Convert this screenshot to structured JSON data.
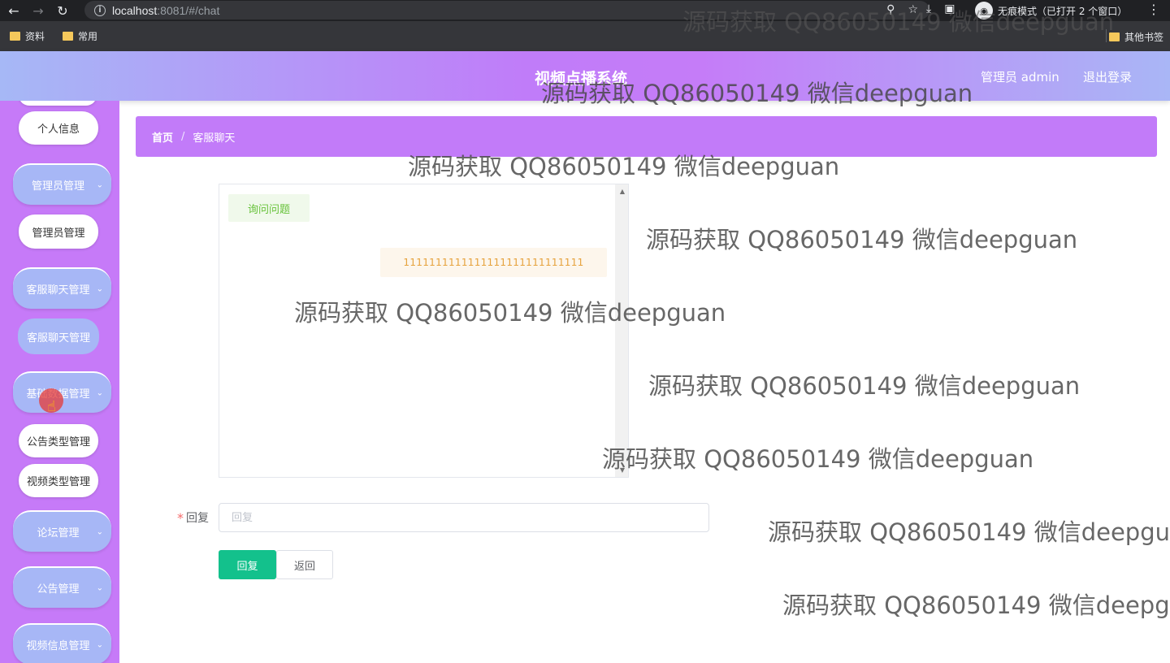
{
  "browser": {
    "url_host": "localhost",
    "url_rest": ":8081/#/chat",
    "incognito_label": "无痕模式（已打开 2 个窗口）",
    "bookmarks": [
      "资料",
      "常用"
    ],
    "other_bookmarks": "其他书签"
  },
  "header": {
    "title": "视频点播系统",
    "admin": "管理员 admin",
    "logout": "退出登录"
  },
  "sidebar": {
    "personal_info": "个人信息",
    "admin_manage_group": "管理员管理",
    "admin_manage": "管理员管理",
    "chat_manage_group": "客服聊天管理",
    "chat_manage": "客服聊天管理",
    "base_data_group": "基础数据管理",
    "notice_type": "公告类型管理",
    "video_type": "视频类型管理",
    "forum_group": "论坛管理",
    "notice_group": "公告管理",
    "video_info_group": "视频信息管理"
  },
  "breadcrumb": {
    "home": "首页",
    "separator": "/",
    "current": "客服聊天"
  },
  "chat": {
    "question": "询问问题",
    "reply_msg": "1111111111111111111111111111"
  },
  "form": {
    "required_mark": "*",
    "reply_label": "回复",
    "reply_placeholder": "回复",
    "submit_label": "回复",
    "back_label": "返回"
  },
  "watermark": "源码获取 QQ86050149 微信deepguan"
}
